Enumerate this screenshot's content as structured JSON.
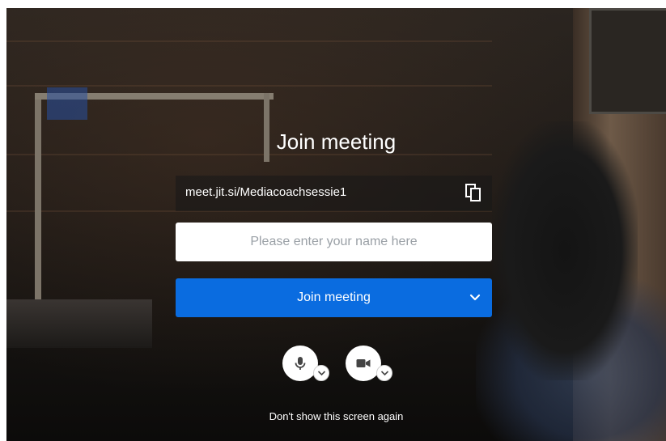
{
  "prejoin": {
    "title": "Join meeting",
    "meeting_url": "meet.jit.si/Mediacoachsessie1",
    "name_placeholder": "Please enter your name here",
    "join_button_label": "Join meeting",
    "dont_show_label": "Don't show this screen again"
  },
  "icons": {
    "copy": "copy-icon",
    "chevron": "chevron-down-icon",
    "microphone": "microphone-icon",
    "camera": "video-camera-icon"
  },
  "colors": {
    "primary": "#0a6ce0",
    "text": "#ffffff",
    "input_background": "#ffffff"
  }
}
